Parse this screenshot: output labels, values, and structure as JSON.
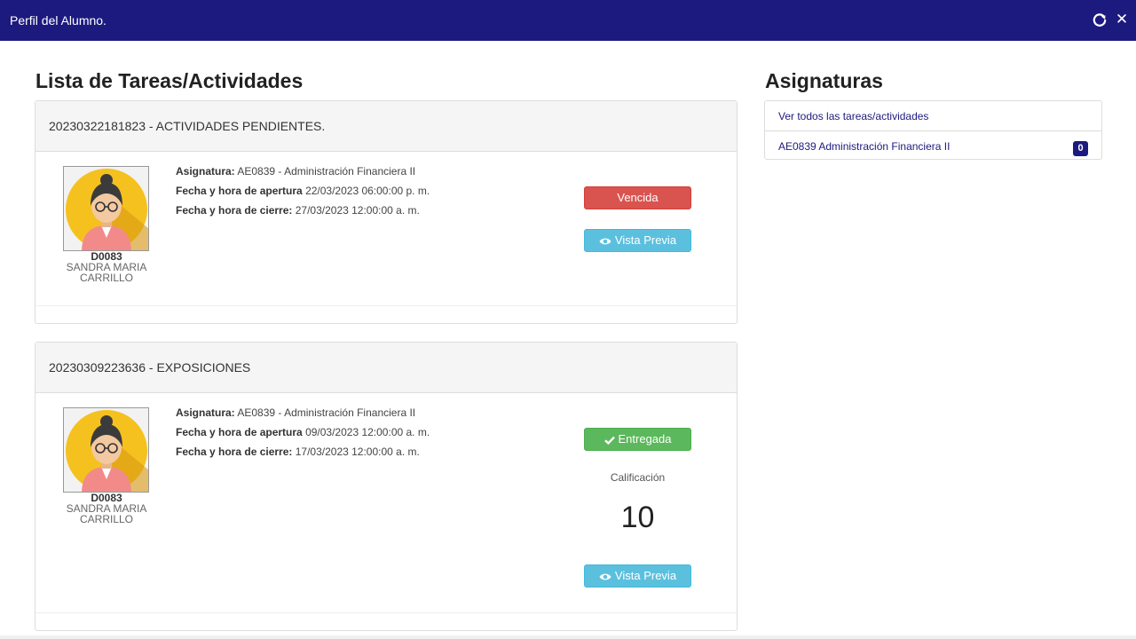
{
  "window": {
    "title": "Perfil del Alumno.",
    "accent_color": "#1c1a7e",
    "refresh_icon": "refresh-icon",
    "close_icon": "close-icon",
    "close_glyph": "✕"
  },
  "tasks": {
    "heading": "Lista de Tareas/Actividades",
    "items": [
      {
        "header": "20230322181823 - ACTIVIDADES PENDIENTES.",
        "teacher_code": "D0083",
        "teacher_name": "SANDRA MARIA CARRILLO",
        "asignatura_label": "Asignatura:",
        "asignatura_value": "AE0839 - Administración Financiera II",
        "apertura_label": "Fecha y hora de apertura",
        "apertura_value": "22/03/2023 06:00:00 p. m.",
        "cierre_label": "Fecha y hora de cierre:",
        "cierre_value": "27/03/2023 12:00:00 a. m.",
        "status_label": "Vencida",
        "status_color": "#d9534f",
        "preview_label": "Vista Previa"
      },
      {
        "header": "20230309223636 - EXPOSICIONES",
        "teacher_code": "D0083",
        "teacher_name": "SANDRA MARIA CARRILLO",
        "asignatura_label": "Asignatura:",
        "asignatura_value": "AE0839 - Administración Financiera II",
        "apertura_label": "Fecha y hora de apertura",
        "apertura_value": "09/03/2023 12:00:00 a. m.",
        "cierre_label": "Fecha y hora de cierre:",
        "cierre_value": "17/03/2023 12:00:00 a. m.",
        "status_label": "Entregada",
        "status_icon": "check-icon",
        "status_color": "#5cb85c",
        "grade_label": "Calificación",
        "grade_value": "10",
        "preview_label": "Vista Previa"
      }
    ]
  },
  "subjects": {
    "heading": "Asignaturas",
    "items": [
      {
        "label": "Ver todos las tareas/actividades"
      },
      {
        "label": "AE0839 Administración Financiera II",
        "badge": "0"
      }
    ]
  }
}
